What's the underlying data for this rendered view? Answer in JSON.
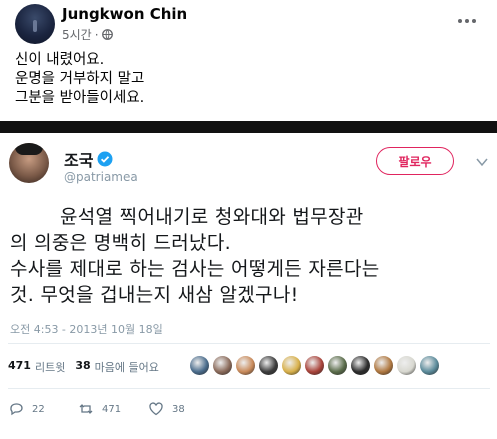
{
  "post": {
    "author": "Jungkwon Chin",
    "time": "5시간",
    "text_lines": [
      "신이 내렸어요.",
      "운명을 거부하지 말고",
      "그분을 받아들이세요."
    ]
  },
  "tweet": {
    "name": "조국",
    "handle": "@patriamea",
    "follow_label": "팔로우",
    "body_lines": [
      "윤석열 찍어내기로 청와대와 법무장관",
      "의 의중은 명백히 드러났다.",
      "수사를 제대로 하는 검사는 어떻게든 자른다는",
      "것. 무엇을 겁내는지 새삼 알겠구나!"
    ],
    "timestamp": "오전 4:53 - 2013년 10월 18일",
    "retweet_count": "471",
    "retweet_label": "리트윗",
    "like_count": "38",
    "like_label": "마음에 들어요",
    "reply_count": "22",
    "action_retweets": "471",
    "action_likes": "38",
    "liker_colors": [
      "#4a6c8c",
      "#8a6a5a",
      "#c98a5a",
      "#3c3c3c",
      "#d8b04a",
      "#a9433a",
      "#5a6c4a",
      "#2c2c2c",
      "#b07840",
      "#d8d8d0",
      "#5a8a9a"
    ]
  },
  "colors": {
    "accent_pink": "#e0245e",
    "verified_blue": "#1da1f2",
    "muted": "#65676b"
  },
  "icons": [
    "globe-icon",
    "more-icon",
    "verified-icon",
    "chevron-down-icon",
    "reply-icon",
    "retweet-icon",
    "heart-icon"
  ]
}
